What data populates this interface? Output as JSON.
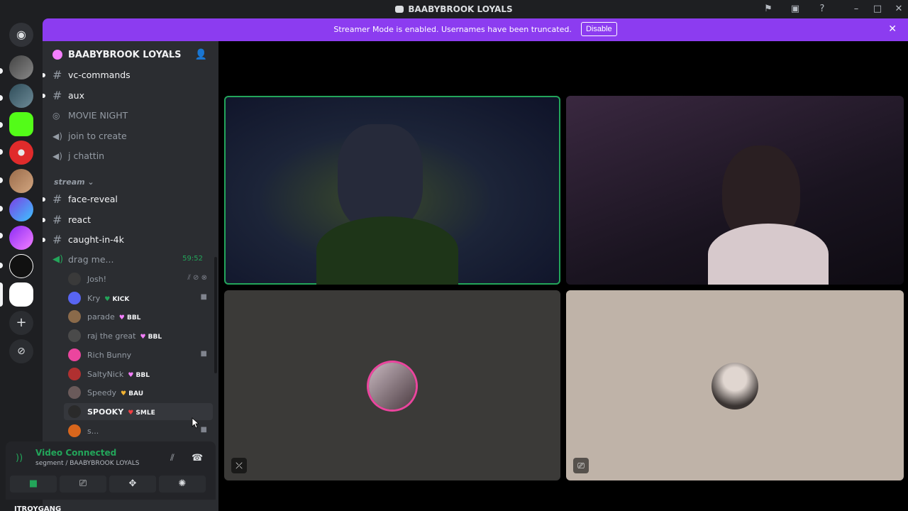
{
  "window": {
    "title": "BAABYBROOK LOYALS",
    "controls": [
      "flag-icon",
      "screen-icon",
      "help-icon",
      "minimize-icon",
      "maximize-icon",
      "close-icon"
    ]
  },
  "banner": {
    "text": "Streamer Mode is enabled. Usernames have been truncated.",
    "button_label": "Disable",
    "color": "#8c3cf0"
  },
  "guild": {
    "name": "BAABYBROOK LOYALS"
  },
  "channels_top": [
    {
      "type": "text",
      "name": "vc-commands",
      "unread": true
    },
    {
      "type": "text",
      "name": "aux",
      "unread": true
    },
    {
      "type": "stage",
      "name": "MOVIE NIGHT",
      "unread": false
    },
    {
      "type": "voice",
      "name": "join to create",
      "unread": false
    },
    {
      "type": "voice",
      "name": "j chattin",
      "unread": false
    }
  ],
  "category": {
    "name": "stream"
  },
  "channels_stream": [
    {
      "type": "text",
      "name": "face-reveal",
      "unread": true
    },
    {
      "type": "text",
      "name": "react",
      "unread": true
    },
    {
      "type": "text",
      "name": "caught-in-4k",
      "unread": true
    }
  ],
  "voice_channel": {
    "name": "drag me...",
    "timer": "59:52",
    "users": [
      {
        "name": "Josh!",
        "tag": "",
        "tag_color": "",
        "icons": "mute-deafen-icons",
        "active": false
      },
      {
        "name": "Kry",
        "tag": "KICK",
        "tag_color": "#23a55a",
        "icons": "camera-icon",
        "active": false
      },
      {
        "name": "parade",
        "tag": "BBL",
        "tag_color": "#f47fff",
        "icons": "",
        "active": false
      },
      {
        "name": "raj the great",
        "tag": "BBL",
        "tag_color": "#f47fff",
        "icons": "",
        "active": false
      },
      {
        "name": "Rich Bunny",
        "tag": "",
        "tag_color": "",
        "icons": "camera-icon",
        "active": false
      },
      {
        "name": "SaltyNick",
        "tag": "BBL",
        "tag_color": "#f47fff",
        "icons": "",
        "active": false
      },
      {
        "name": "Speedy",
        "tag": "BAU",
        "tag_color": "#f0b232",
        "icons": "",
        "active": false
      },
      {
        "name": "SPOOKY",
        "tag": "SMLE",
        "tag_color": "#f23f43",
        "icons": "",
        "active": true
      },
      {
        "name": "s...",
        "tag": "",
        "tag_color": "",
        "icons": "camera-icon",
        "active": false
      }
    ]
  },
  "voice_panel": {
    "status": "Video Connected",
    "location": "segment / BAABYBROOK LOYALS",
    "buttons": [
      "camera",
      "screen-share",
      "activities",
      "soundboard"
    ]
  },
  "user_bar": {
    "name": "JTROYGANG"
  },
  "colors": {
    "accent_green": "#23a55a",
    "sidebar_bg": "#2b2d31",
    "rail_bg": "#1e1f22",
    "stage_bg": "#000000"
  }
}
